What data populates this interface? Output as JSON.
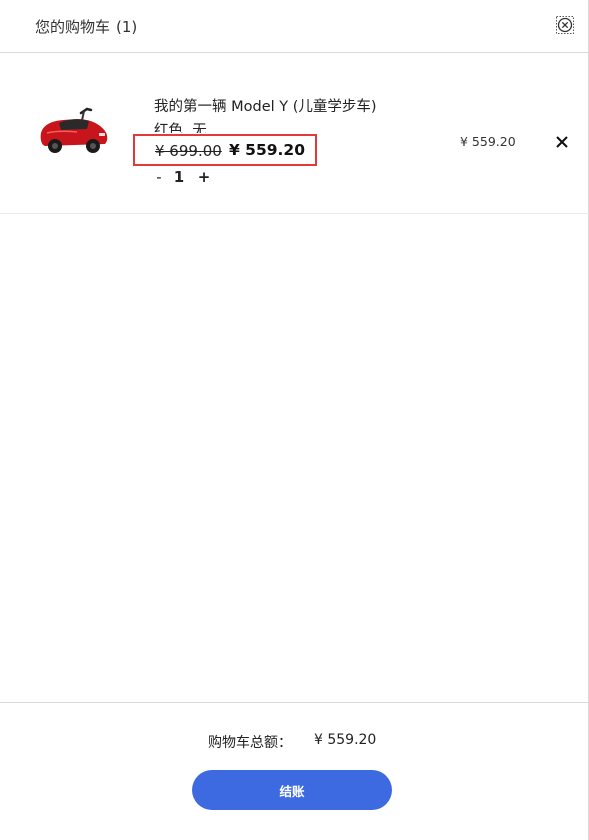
{
  "header": {
    "title": "您的购物车",
    "count": "(1)",
    "close_icon": "close-circle-icon"
  },
  "cart": {
    "items": [
      {
        "name": "我的第一辆 Model Y (儿童学步车)",
        "variant": "红色, 无",
        "original_price": "¥ 699.00",
        "sale_price": "¥ 559.20",
        "quantity": "1",
        "minus_label": "-",
        "plus_label": "+",
        "line_total": "¥ 559.20",
        "thumbnail": "red-kids-car-image",
        "remove_icon": "close-icon"
      }
    ]
  },
  "colors": {
    "highlight_border": "#e23a3a",
    "checkout_button": "#3e6ae1"
  },
  "footer": {
    "total_label": "购物车总额：",
    "total_value": "¥ 559.20",
    "checkout_label": "结账"
  }
}
